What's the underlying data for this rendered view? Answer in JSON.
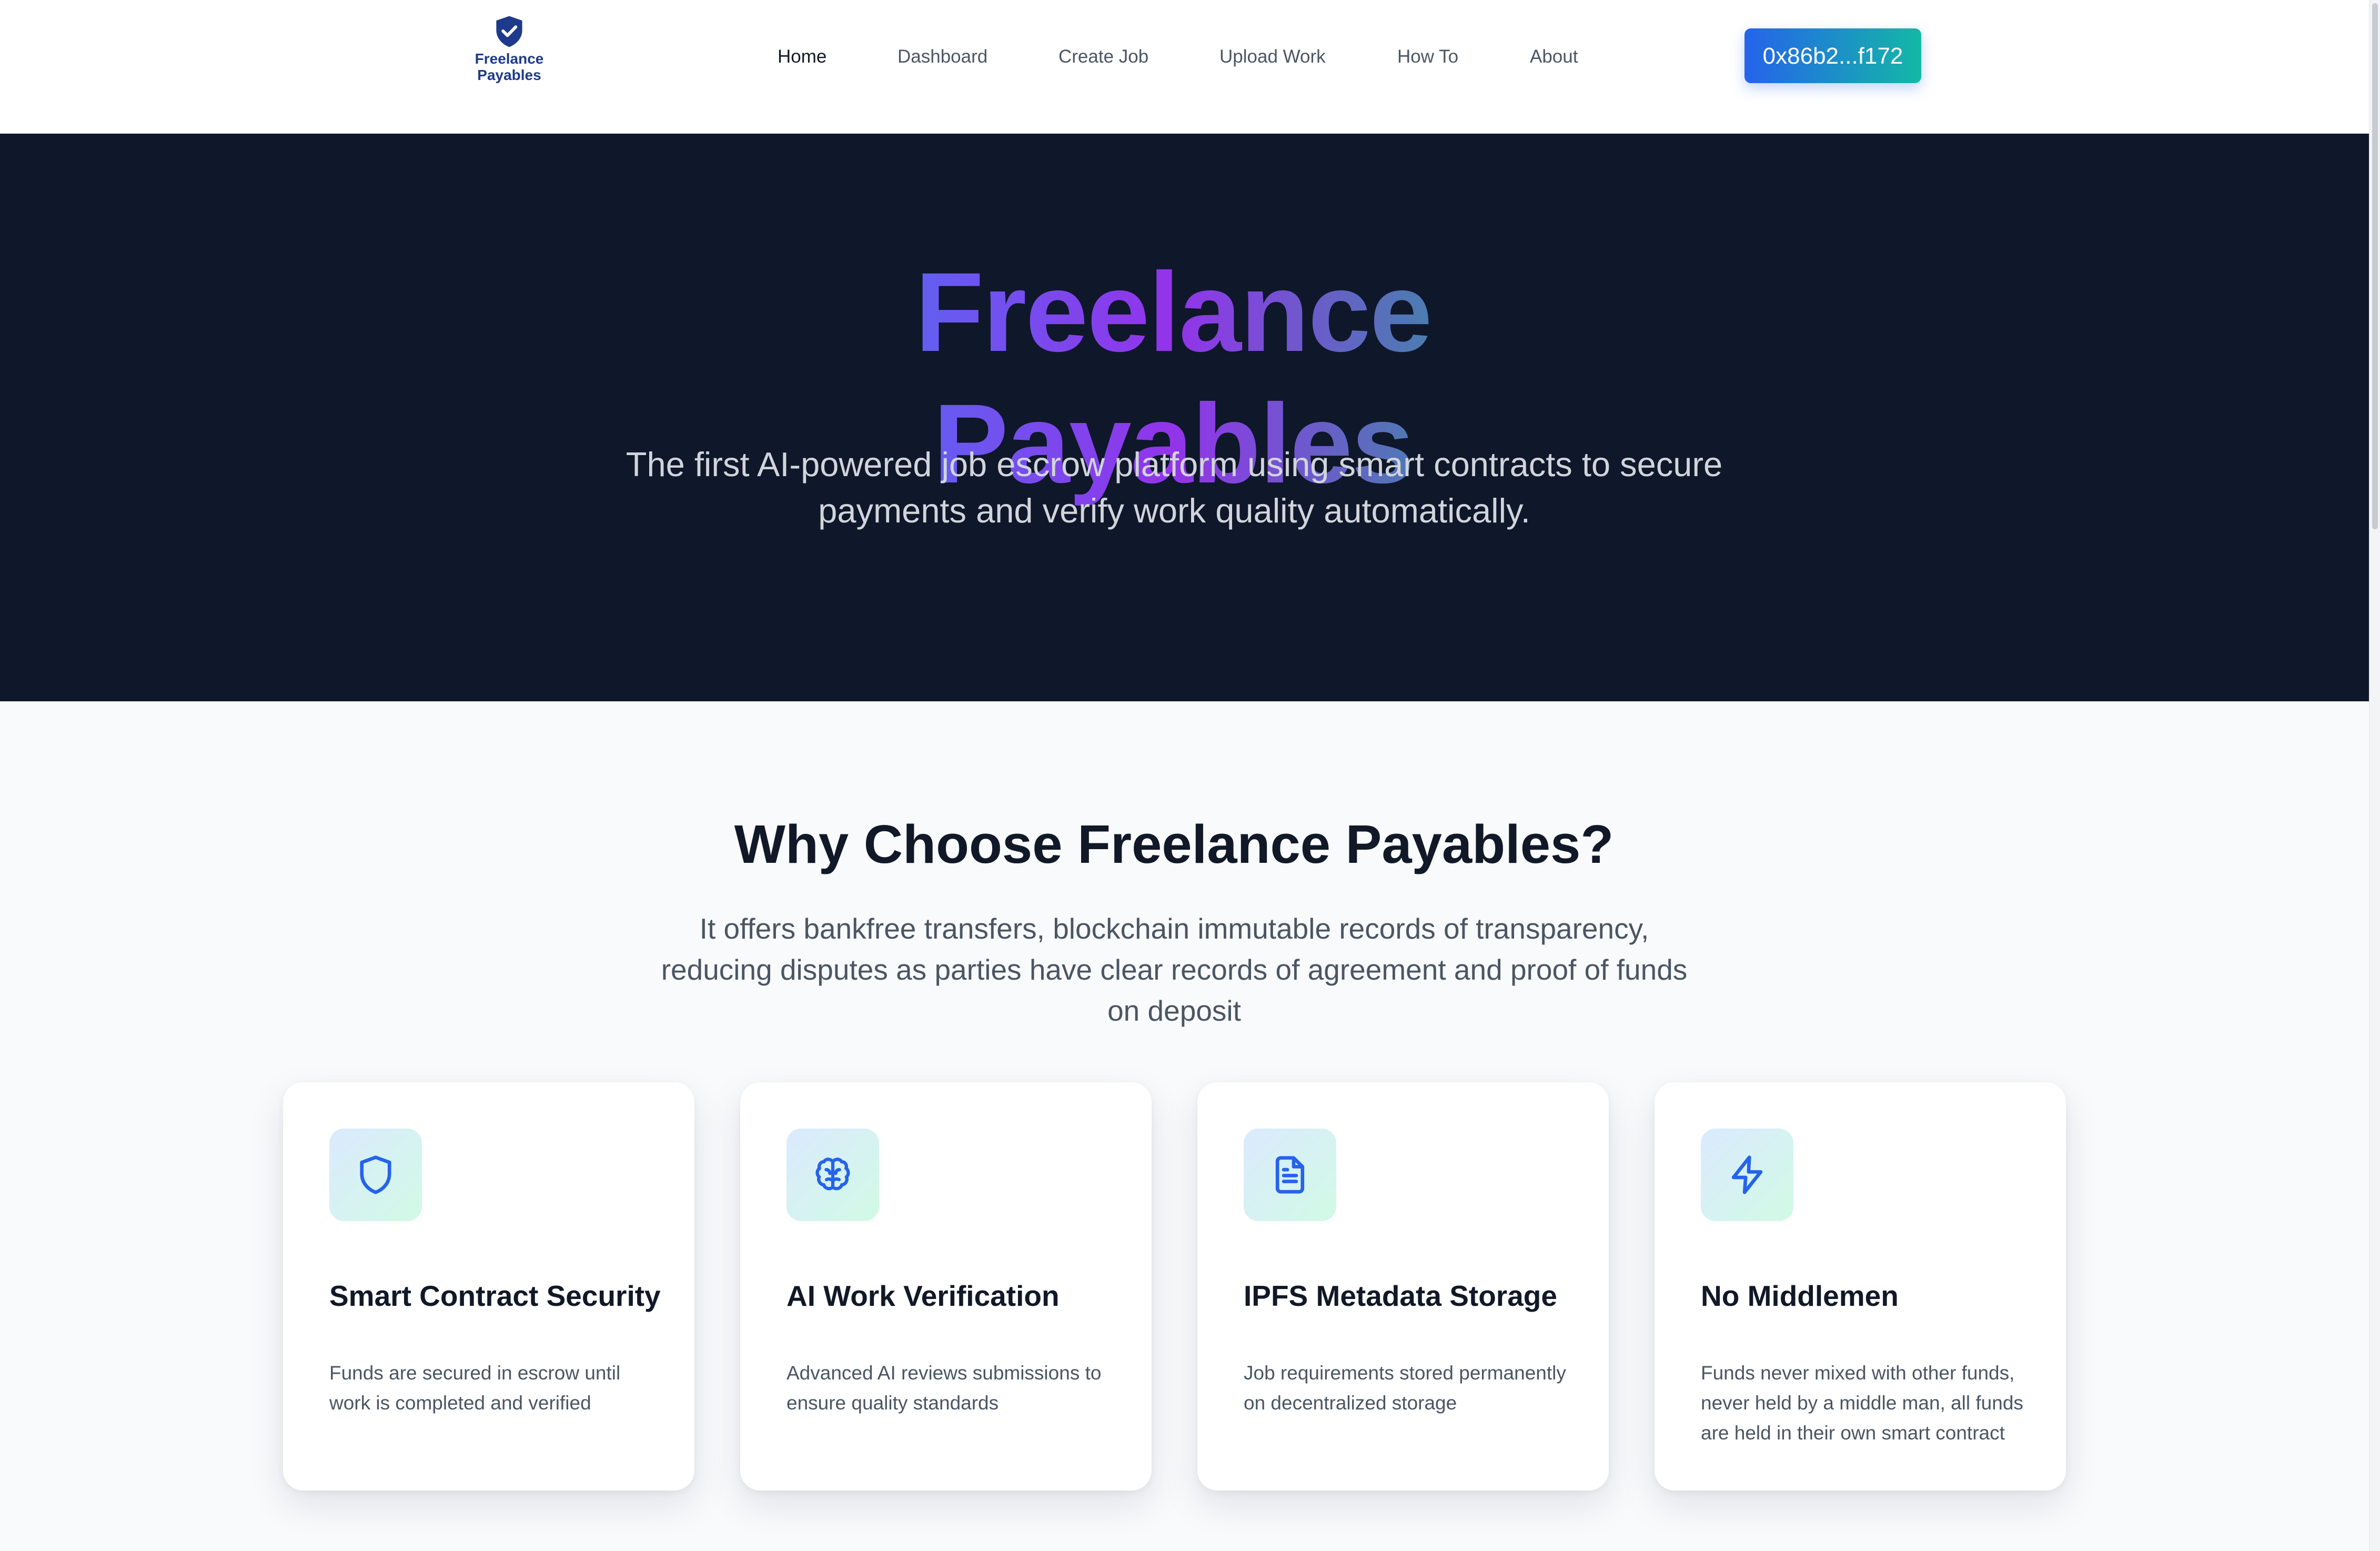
{
  "app": {
    "logo_line1": "Freelance",
    "logo_line2": "Payables",
    "logo_icon": "shield-check-icon",
    "brand_color": "#1e3a8a"
  },
  "nav": {
    "items": [
      {
        "label": "Home",
        "active": true
      },
      {
        "label": "Dashboard",
        "active": false
      },
      {
        "label": "Create Job",
        "active": false
      },
      {
        "label": "Upload Work",
        "active": false
      },
      {
        "label": "How To",
        "active": false
      },
      {
        "label": "About",
        "active": false
      }
    ]
  },
  "wallet": {
    "address_label": "0x86b2...f172",
    "gradient": [
      "#2563eb",
      "#14b8a6"
    ]
  },
  "hero": {
    "title": "Freelance Payables",
    "subtitle": "The first AI-powered job escrow platform using smart contracts to secure payments and verify work quality automatically.",
    "background": "#0f172a",
    "title_gradient": [
      "#3b82f6",
      "#9333ea",
      "#10b981"
    ]
  },
  "features": {
    "title": "Why Choose Freelance Payables?",
    "subtitle": "It offers bankfree transfers, blockchain immutable records of transparency, reducing disputes as parties have clear records of agreement and proof of funds on deposit",
    "cards": [
      {
        "icon": "shield-icon",
        "title": "Smart Contract Security",
        "text": "Funds are secured in escrow until work is completed and verified"
      },
      {
        "icon": "brain-icon",
        "title": "AI Work Verification",
        "text": "Advanced AI reviews submissions to ensure quality standards"
      },
      {
        "icon": "document-icon",
        "title": "IPFS Metadata Storage",
        "text": "Job requirements stored permanently on decentralized storage"
      },
      {
        "icon": "lightning-icon",
        "title": "No Middlemen",
        "text": "Funds never mixed with other funds, never held by a middle man, all funds are held in their own smart contract"
      }
    ],
    "icon_color": "#2563eb"
  }
}
